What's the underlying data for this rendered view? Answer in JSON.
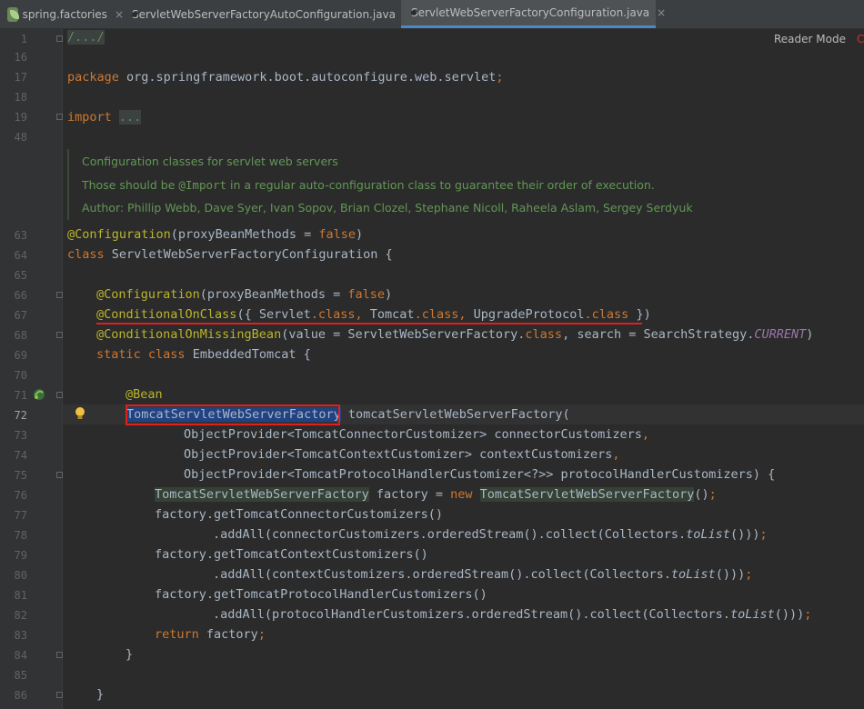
{
  "tabs": [
    {
      "label": "spring.factories",
      "close": "×",
      "icon": "spring-factories-icon"
    },
    {
      "label": "ServletWebServerFactoryAutoConfiguration.java",
      "close": "×",
      "icon": "java-class-icon"
    },
    {
      "label": "ServletWebServerFactoryConfiguration.java",
      "close": "×",
      "icon": "java-class-icon",
      "active": true
    }
  ],
  "reader_mode": "Reader Mode",
  "edge_glyph": "C",
  "colors": {
    "keyword": "#cc7832",
    "annotation": "#bbb529",
    "comment": "#629755",
    "constant": "#9876aa",
    "highlight_red": "#e0201f",
    "selection": "#214283"
  },
  "line_numbers": [
    "1",
    "16",
    "17",
    "18",
    "19",
    "48",
    "63",
    "64",
    "65",
    "66",
    "67",
    "68",
    "69",
    "70",
    "71",
    "72",
    "73",
    "74",
    "75",
    "76",
    "77",
    "78",
    "79",
    "80",
    "81",
    "82",
    "83",
    "84",
    "85",
    "86"
  ],
  "current_line": "72",
  "code": {
    "l1": "/.../",
    "l17_kw": "package",
    "l17_rest": " org.springframework.boot.autoconfigure.web.servlet",
    "semi": ";",
    "l19_kw": "import",
    "l19_fold": "...",
    "doc": {
      "line1": "Configuration classes for servlet web servers",
      "line2_pre": "Those should be ",
      "line2_code": "@Import",
      "line2_post": " in a regular auto-configuration class to guarantee their order of execution.",
      "line3": "Author: Phillip Webb, Dave Syer, Ivan Sopov, Brian Clozel, Stephane Nicoll, Raheela Aslam, Sergey Serdyuk"
    },
    "ann_configuration": "@Configuration",
    "proxy_open": "(proxyBeanMethods = ",
    "false_kw": "false",
    "close_paren": ")",
    "class_kw": "class",
    "l64_rest": " ServletWebServerFactoryConfiguration {",
    "ann_conditional_on_class": "@ConditionalOnClass",
    "l67_open": "({ ",
    "servlet": "Servlet",
    "dot_class": ".class",
    "comma": ", ",
    "tomcat": "Tomcat",
    "upgrade_protocol": "UpgradeProtocol",
    "l67_close": " })",
    "ann_conditional_on_missing_bean": "@ConditionalOnMissingBean",
    "l68_mid": "(value = ServletWebServerFactory.",
    "class_word": "class",
    "l68_search": ", search = SearchStrategy.",
    "current": "CURRENT",
    "static_kw": "static",
    "space": " ",
    "l69_rest": " EmbeddedTomcat {",
    "ann_bean": "@Bean",
    "l72_type": "TomcatServletWebServerFactory",
    "l72_method": " tomcatServletWebServerFactory(",
    "l73_text": "ObjectProvider<TomcatConnectorCustomizer> connectorCustomizers",
    "l73_comma": ",",
    "l74_text": "ObjectProvider<TomcatContextCustomizer> contextCustomizers",
    "l74_comma": ",",
    "l75_text": "ObjectProvider<TomcatProtocolHandlerCustomizer<?>> protocolHandlerCustomizers) {",
    "l76_type": "TomcatServletWebServerFactory",
    "l76_mid": " factory = ",
    "new_kw": "new",
    "l76_type2": "TomcatServletWebServerFactory",
    "l76_end": "()",
    "l77": "factory.getTomcatConnectorCustomizers()",
    "l78_pre": ".addAll(connectorCustomizers.orderedStream().collect(Collectors.",
    "to_list": "toList",
    "l78_post": "()))",
    "l79": "factory.getTomcatContextCustomizers()",
    "l80_pre": ".addAll(contextCustomizers.orderedStream().collect(Collectors.",
    "l80_post": "()))",
    "l81": "factory.getTomcatProtocolHandlerCustomizers()",
    "l82_pre": ".addAll(protocolHandlerCustomizers.orderedStream().collect(Collectors.",
    "l82_post": "()))",
    "return_kw": "return",
    "l83_rest": " factory",
    "brace": "}"
  }
}
